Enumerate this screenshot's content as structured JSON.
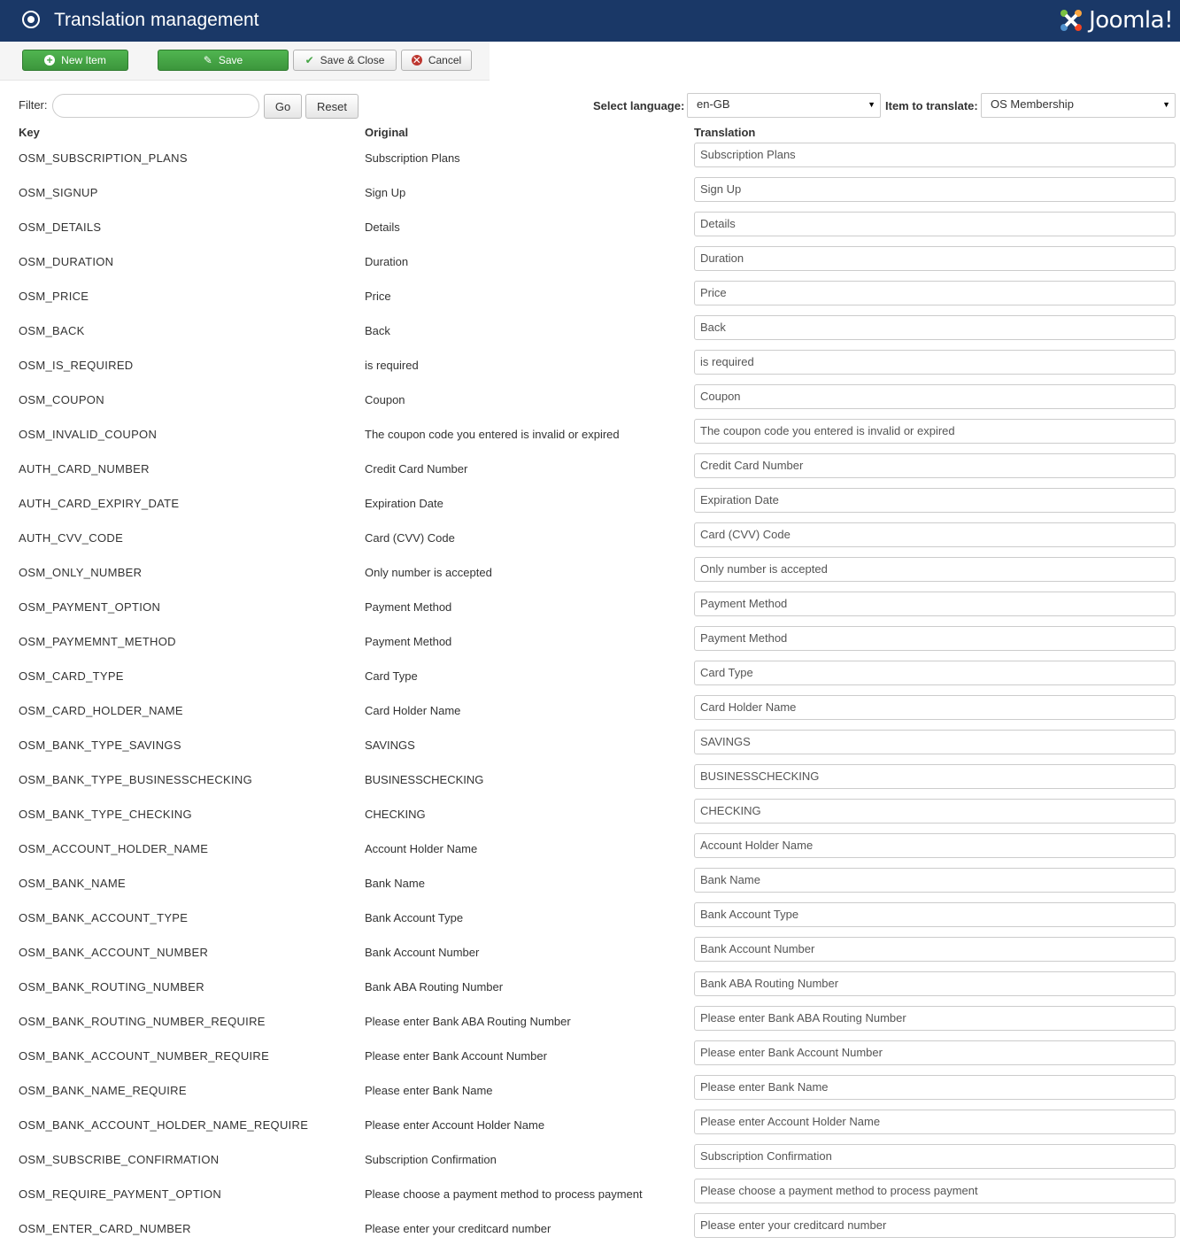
{
  "header": {
    "title": "Translation management",
    "logo_text": "Joomla!"
  },
  "toolbar": {
    "new_label": "New Item",
    "save_label": "Save",
    "save_close_label": "Save & Close",
    "cancel_label": "Cancel"
  },
  "filter": {
    "label": "Filter:",
    "value": "",
    "go_label": "Go",
    "reset_label": "Reset"
  },
  "language": {
    "label": "Select language:",
    "selected": "en-GB"
  },
  "item": {
    "label": "Item to translate:",
    "selected": "OS Membership"
  },
  "columns": {
    "key": "Key",
    "original": "Original",
    "translation": "Translation"
  },
  "rows": [
    {
      "key": "OSM_SUBSCRIPTION_PLANS",
      "original": "Subscription Plans",
      "translation": "Subscription Plans"
    },
    {
      "key": "OSM_SIGNUP",
      "original": "Sign Up",
      "translation": "Sign Up"
    },
    {
      "key": "OSM_DETAILS",
      "original": "Details",
      "translation": "Details"
    },
    {
      "key": "OSM_DURATION",
      "original": "Duration",
      "translation": "Duration"
    },
    {
      "key": "OSM_PRICE",
      "original": "Price",
      "translation": "Price"
    },
    {
      "key": "OSM_BACK",
      "original": "Back",
      "translation": "Back"
    },
    {
      "key": "OSM_IS_REQUIRED",
      "original": "is required",
      "translation": " is required"
    },
    {
      "key": "OSM_COUPON",
      "original": "Coupon",
      "translation": "Coupon"
    },
    {
      "key": "OSM_INVALID_COUPON",
      "original": "The coupon code you entered is invalid or expired",
      "translation": "The coupon code you entered is invalid or expired"
    },
    {
      "key": "AUTH_CARD_NUMBER",
      "original": "Credit Card Number",
      "translation": "Credit Card Number"
    },
    {
      "key": "AUTH_CARD_EXPIRY_DATE",
      "original": "Expiration Date",
      "translation": "Expiration Date"
    },
    {
      "key": "AUTH_CVV_CODE",
      "original": "Card (CVV) Code",
      "translation": "Card (CVV) Code"
    },
    {
      "key": "OSM_ONLY_NUMBER",
      "original": "Only number is accepted",
      "translation": "Only number is accepted"
    },
    {
      "key": "OSM_PAYMENT_OPTION",
      "original": "Payment Method",
      "translation": "Payment Method"
    },
    {
      "key": "OSM_PAYMEMNT_METHOD",
      "original": "Payment Method",
      "translation": "Payment Method"
    },
    {
      "key": "OSM_CARD_TYPE",
      "original": "Card Type",
      "translation": "Card Type"
    },
    {
      "key": "OSM_CARD_HOLDER_NAME",
      "original": "Card Holder Name",
      "translation": "Card Holder Name"
    },
    {
      "key": "OSM_BANK_TYPE_SAVINGS",
      "original": "SAVINGS",
      "translation": "SAVINGS"
    },
    {
      "key": "OSM_BANK_TYPE_BUSINESSCHECKING",
      "original": "BUSINESSCHECKING",
      "translation": "BUSINESSCHECKING"
    },
    {
      "key": "OSM_BANK_TYPE_CHECKING",
      "original": "CHECKING",
      "translation": "CHECKING"
    },
    {
      "key": "OSM_ACCOUNT_HOLDER_NAME",
      "original": "Account Holder Name",
      "translation": "Account Holder Name"
    },
    {
      "key": "OSM_BANK_NAME",
      "original": "Bank Name",
      "translation": "Bank Name"
    },
    {
      "key": "OSM_BANK_ACCOUNT_TYPE",
      "original": "Bank Account Type",
      "translation": "Bank Account Type"
    },
    {
      "key": "OSM_BANK_ACCOUNT_NUMBER",
      "original": "Bank Account Number",
      "translation": "Bank Account Number"
    },
    {
      "key": "OSM_BANK_ROUTING_NUMBER",
      "original": "Bank ABA Routing Number",
      "translation": "Bank ABA Routing Number"
    },
    {
      "key": "OSM_BANK_ROUTING_NUMBER_REQUIRE",
      "original": "Please enter Bank ABA Routing Number",
      "translation": "Please enter Bank ABA Routing Number"
    },
    {
      "key": "OSM_BANK_ACCOUNT_NUMBER_REQUIRE",
      "original": "Please enter Bank Account Number",
      "translation": "Please enter Bank Account Number"
    },
    {
      "key": "OSM_BANK_NAME_REQUIRE",
      "original": "Please enter Bank Name",
      "translation": "Please enter Bank Name"
    },
    {
      "key": "OSM_BANK_ACCOUNT_HOLDER_NAME_REQUIRE",
      "original": "Please enter Account Holder Name",
      "translation": "Please enter Account Holder Name"
    },
    {
      "key": "OSM_SUBSCRIBE_CONFIRMATION",
      "original": "Subscription Confirmation",
      "translation": "Subscription Confirmation"
    },
    {
      "key": "OSM_REQUIRE_PAYMENT_OPTION",
      "original": "Please choose a payment method to process payment",
      "translation": "Please choose a payment method to process payment"
    },
    {
      "key": "OSM_ENTER_CARD_NUMBER",
      "original": "Please enter your creditcard number",
      "translation": "Please enter your creditcard number"
    }
  ]
}
